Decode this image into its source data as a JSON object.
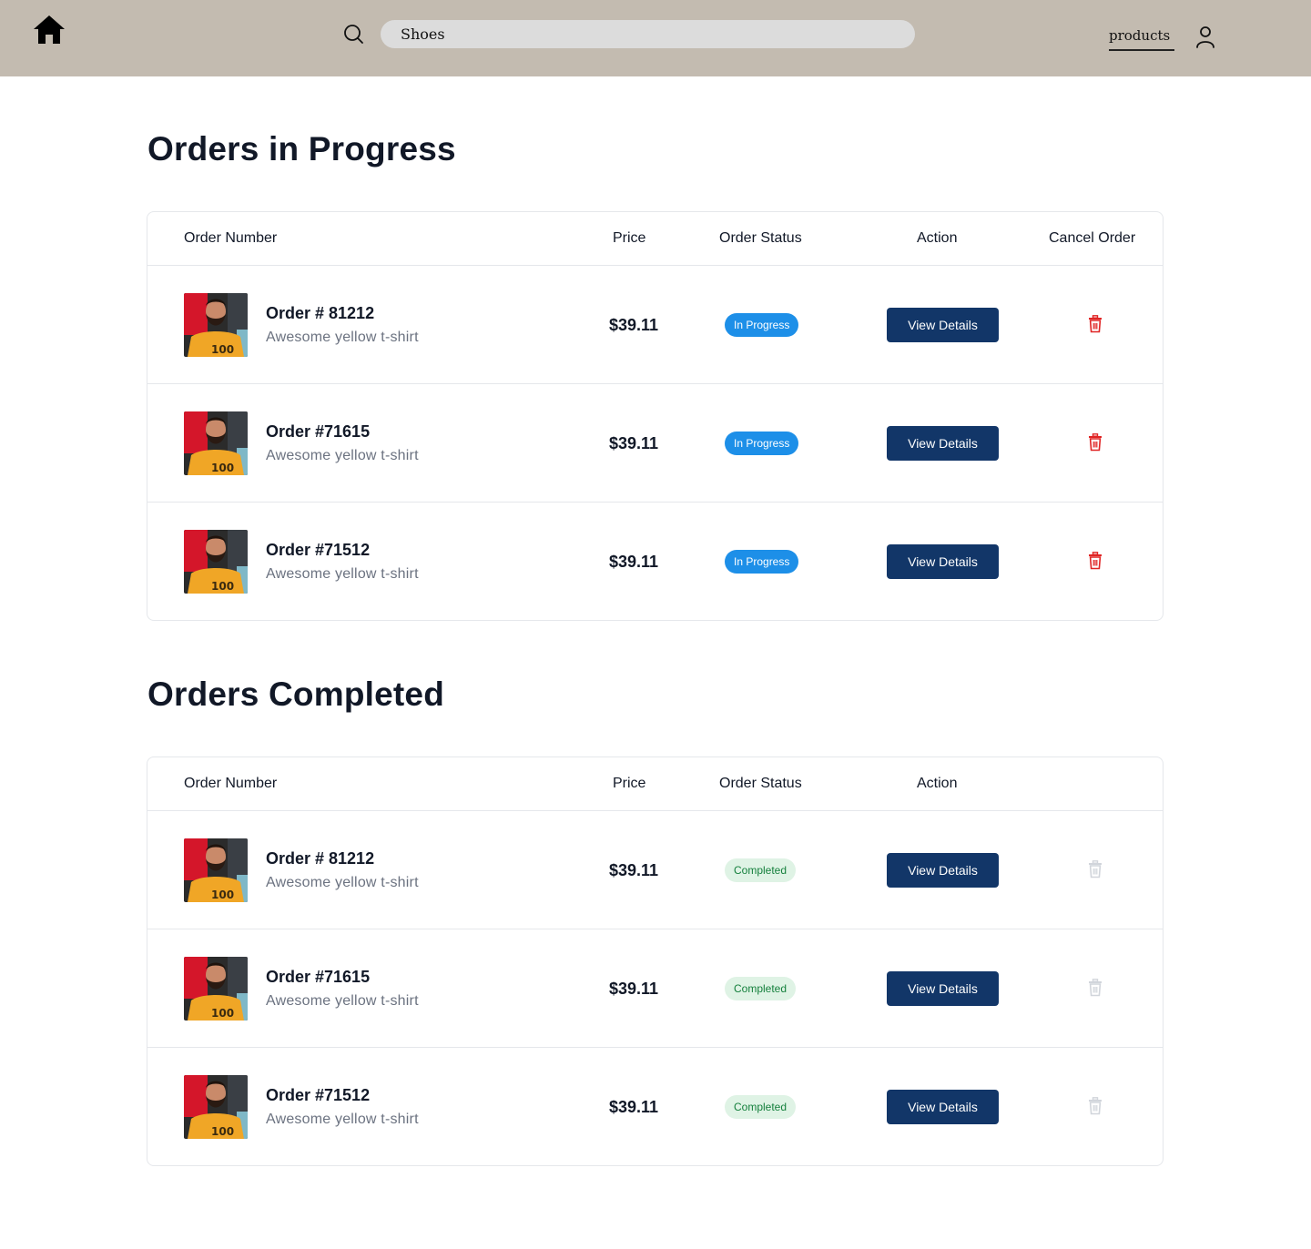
{
  "header": {
    "search_value": "Shoes",
    "nav_link": "products",
    "background_color": "#c3bbb0"
  },
  "sections": {
    "in_progress": {
      "title": "Orders in Progress",
      "columns": [
        "Order Number",
        "Price",
        "Order Status",
        "Action",
        "Cancel Order"
      ],
      "rows": [
        {
          "order": "Order # 81212",
          "product": "Awesome yellow t-shirt",
          "price": "$39.11",
          "status": "In Progress",
          "action": "View Details"
        },
        {
          "order": "Order #71615",
          "product": "Awesome yellow t-shirt",
          "price": "$39.11",
          "status": "In Progress",
          "action": "View Details"
        },
        {
          "order": "Order #71512",
          "product": "Awesome yellow t-shirt",
          "price": "$39.11",
          "status": "In Progress",
          "action": "View Details"
        }
      ]
    },
    "completed": {
      "title": "Orders Completed",
      "columns": [
        "Order Number",
        "Price",
        "Order Status",
        "Action"
      ],
      "rows": [
        {
          "order": "Order # 81212",
          "product": "Awesome yellow t-shirt",
          "price": "$39.11",
          "status": "Completed",
          "action": "View Details"
        },
        {
          "order": "Order #71615",
          "product": "Awesome yellow t-shirt",
          "price": "$39.11",
          "status": "Completed",
          "action": "View Details"
        },
        {
          "order": "Order #71512",
          "product": "Awesome yellow t-shirt",
          "price": "$39.11",
          "status": "Completed",
          "action": "View Details"
        }
      ]
    }
  },
  "icons": {
    "home": "home-icon",
    "search": "search-icon",
    "user": "user-icon",
    "cancel": "trash-icon"
  },
  "colors": {
    "primary_button": "#123668",
    "in_progress_badge": "#1d8fe8",
    "completed_badge_bg": "#dff3e5",
    "completed_badge_text": "#15803d",
    "cancel_active": "#e02424",
    "cancel_disabled": "#d1d5db"
  }
}
